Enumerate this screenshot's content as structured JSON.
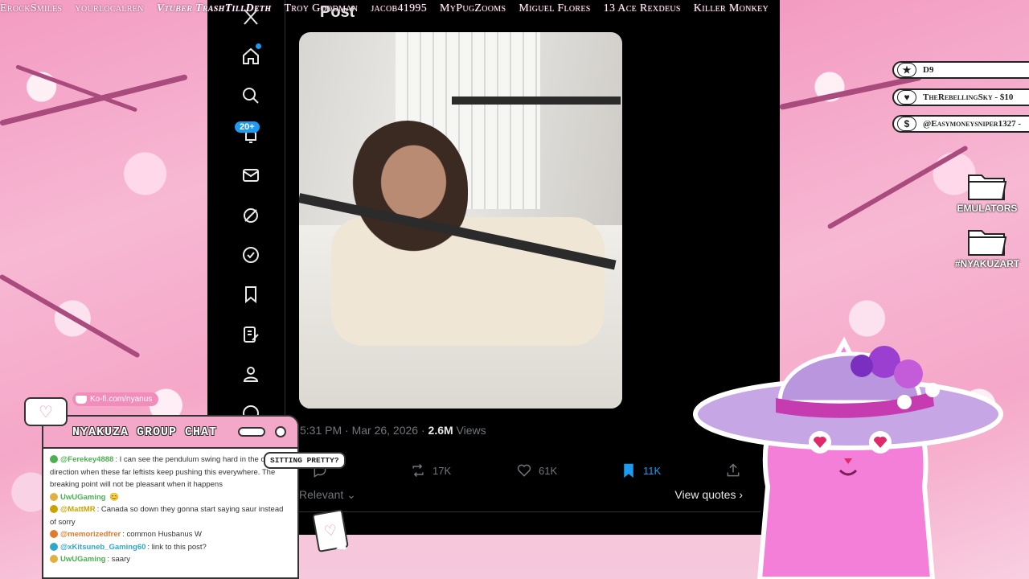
{
  "ticker": [
    "ErockSmiles",
    "yourlocalren",
    "Vtuber TrashTillDeth",
    "Troy Goodman",
    "jacob41995",
    "MyPugZooms",
    "Miguel Flores",
    "13 Ace Rexdeus",
    "Killer Monkey"
  ],
  "twitter": {
    "post_header": "Post",
    "notification_badge": "20+",
    "timestamp": "5:31 PM · Mar 26, 2026 · ",
    "views_count": "2.6M",
    "views_label": " Views",
    "retweets": "17K",
    "likes": "61K",
    "bookmarks": "11K",
    "relevant_label": "Relevant",
    "view_quotes_label": "View quotes"
  },
  "donations": [
    {
      "icon": "star-icon",
      "symbol": "★",
      "text": "D9"
    },
    {
      "icon": "heart-icon",
      "symbol": "♥",
      "text": "TheRebellingSky - $10"
    },
    {
      "icon": "dollar-icon",
      "symbol": "$",
      "text": "@Easymoneysniper1327 -"
    }
  ],
  "folders": [
    {
      "label": "EMULATORS"
    },
    {
      "label": "#NYAKUZART"
    }
  ],
  "chat": {
    "kofi": "Ko-fi.com/nyanus",
    "title": "NYAKUZA GROUP CHAT",
    "messages": [
      {
        "user": "@Ferekey4888",
        "text": "I can see the pendulum swing hard in the opposite direction when these far leftists keep pushing this everywhere. The breaking point will not be pleasant when it happens",
        "color": "#4caf50"
      },
      {
        "user": "UwUGaming",
        "text": "",
        "color": "#4caf50"
      },
      {
        "user": "@MattMR",
        "text": "Canada so down they gonna start saying saur instead of sorry",
        "color": "#c9a400"
      },
      {
        "user": "@memorizedfrer",
        "text": "common Husbanus W",
        "color": "#e07a2f"
      },
      {
        "user": "@xKitsuneb_Gaming60",
        "text": "link to this post?",
        "color": "#2fa7c9"
      },
      {
        "user": "UwUGaming",
        "text": "saary",
        "color": "#4caf50"
      }
    ]
  },
  "sitting_label": "SITTING PRETTY?",
  "colors": {
    "accent": "#1d9bf0",
    "pink": "#f4a8c9",
    "panel_bg": "#000000"
  }
}
